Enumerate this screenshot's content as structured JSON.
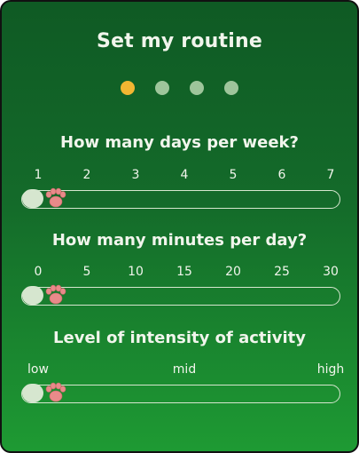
{
  "title": "Set my routine",
  "steps": {
    "total": 4,
    "current": 1,
    "active_color": "#f2b632",
    "inactive_color": "#9ec59b"
  },
  "sliders": [
    {
      "question": "How many days per week?",
      "ticks": [
        "1",
        "2",
        "3",
        "4",
        "5",
        "6",
        "7"
      ],
      "value_fraction": 0,
      "thumb_icon": "paw-icon"
    },
    {
      "question": "How many minutes per day?",
      "ticks": [
        "0",
        "5",
        "10",
        "15",
        "20",
        "25",
        "30"
      ],
      "value_fraction": 0,
      "thumb_icon": "paw-icon"
    },
    {
      "question": "Level of intensity of activity",
      "ticks": [
        "low",
        "mid",
        "high"
      ],
      "value_fraction": 0,
      "thumb_icon": "paw-icon"
    }
  ],
  "colors": {
    "background_top": "#0f5a24",
    "background_bottom": "#1e9a33",
    "text": "#f1f5ec",
    "paw": "#e98a8a"
  }
}
